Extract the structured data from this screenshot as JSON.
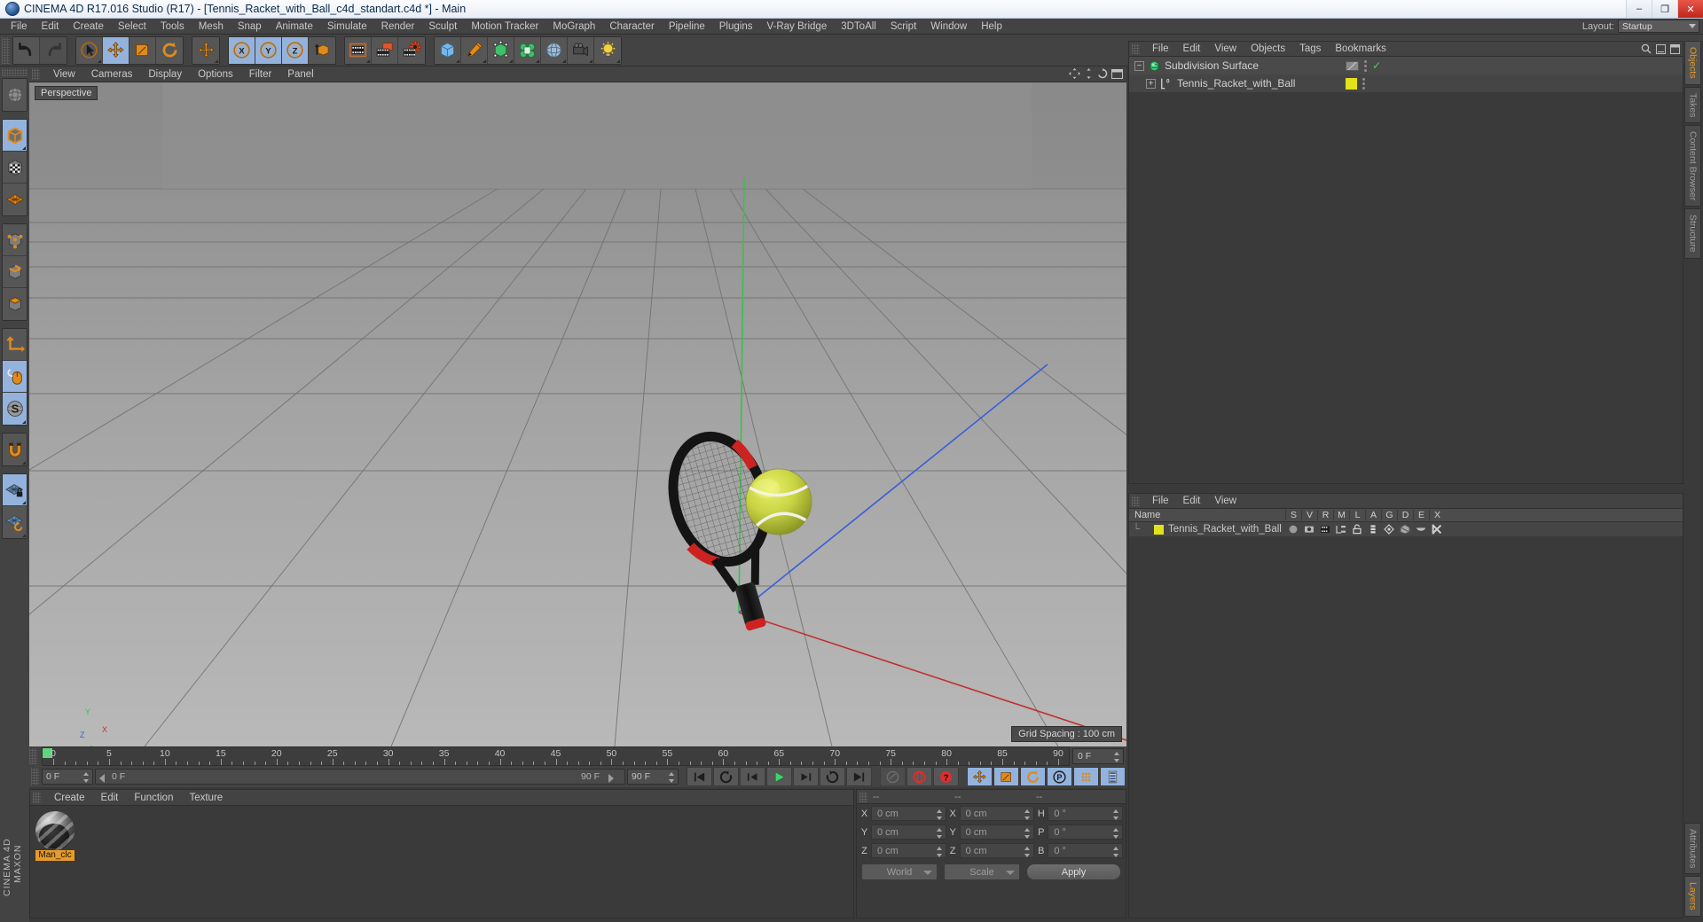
{
  "window": {
    "title": "CINEMA 4D R17.016 Studio (R17) - [Tennis_Racket_with_Ball_c4d_standart.c4d *] - Main",
    "minimize": "–",
    "maximize": "❐",
    "close": "✕"
  },
  "menubar": {
    "items": [
      "File",
      "Edit",
      "Create",
      "Select",
      "Tools",
      "Mesh",
      "Snap",
      "Animate",
      "Simulate",
      "Render",
      "Sculpt",
      "Motion Tracker",
      "MoGraph",
      "Character",
      "Pipeline",
      "Plugins",
      "V-Ray Bridge",
      "3DToAll",
      "Script",
      "Window",
      "Help"
    ],
    "layout_label": "Layout:",
    "layout_value": "Startup"
  },
  "toolbar": {
    "groups": [
      {
        "name": "undo-redo",
        "buttons": [
          {
            "name": "undo-button",
            "icon": "undo-icon",
            "active": false,
            "dim": false,
            "corner": false
          },
          {
            "name": "redo-button",
            "icon": "redo-icon",
            "active": false,
            "dim": true,
            "corner": false
          }
        ]
      },
      {
        "name": "transform-tools",
        "buttons": [
          {
            "name": "live-selection-tool",
            "icon": "cursor-circle-icon",
            "active": false,
            "dim": false,
            "corner": true
          },
          {
            "name": "move-tool",
            "icon": "move-arrows-icon",
            "active": true,
            "dim": false,
            "corner": false
          },
          {
            "name": "scale-tool",
            "icon": "scale-box-icon",
            "active": false,
            "dim": false,
            "corner": false
          },
          {
            "name": "rotate-tool",
            "icon": "rotate-icon",
            "active": false,
            "dim": false,
            "corner": false
          }
        ]
      },
      {
        "name": "axis-tools",
        "buttons": [
          {
            "name": "world-axis-toggle",
            "icon": "move-arrows-icon",
            "active": false,
            "dim": false,
            "corner": true
          }
        ]
      },
      {
        "name": "axis-locks",
        "buttons": [
          {
            "name": "lock-x-axis",
            "icon": "axis-x-icon",
            "active": true,
            "dim": false,
            "corner": false
          },
          {
            "name": "lock-y-axis",
            "icon": "axis-y-icon",
            "active": true,
            "dim": false,
            "corner": false
          },
          {
            "name": "lock-z-axis",
            "icon": "axis-z-icon",
            "active": true,
            "dim": false,
            "corner": false
          },
          {
            "name": "object-world-coordinate-toggle",
            "icon": "world-object-cube-icon",
            "active": false,
            "dim": false,
            "corner": false
          }
        ]
      },
      {
        "name": "render-tools",
        "buttons": [
          {
            "name": "render-view-button",
            "icon": "render-view-icon",
            "active": false,
            "dim": false,
            "corner": true
          },
          {
            "name": "render-to-picture-viewer-button",
            "icon": "render-picture-icon",
            "active": false,
            "dim": false,
            "corner": false
          },
          {
            "name": "edit-render-settings-button",
            "icon": "render-settings-icon",
            "active": false,
            "dim": false,
            "corner": false
          }
        ]
      },
      {
        "name": "object-creation",
        "buttons": [
          {
            "name": "add-primitive-cube-button",
            "icon": "cube-blue-icon",
            "active": false,
            "dim": false,
            "corner": true
          },
          {
            "name": "add-spline-pen-button",
            "icon": "pen-icon",
            "active": false,
            "dim": false,
            "corner": true
          },
          {
            "name": "add-generator-button",
            "icon": "generator-green-icon",
            "active": false,
            "dim": false,
            "corner": true
          },
          {
            "name": "add-deformer-button",
            "icon": "deformer-green-icon",
            "active": false,
            "dim": false,
            "corner": true
          },
          {
            "name": "add-environment-button",
            "icon": "sky-environment-icon",
            "active": false,
            "dim": false,
            "corner": true
          },
          {
            "name": "add-camera-button",
            "icon": "camera-icon",
            "active": false,
            "dim": false,
            "corner": true
          },
          {
            "name": "add-light-button",
            "icon": "light-bulb-icon",
            "active": false,
            "dim": false,
            "corner": true
          }
        ]
      }
    ]
  },
  "left_toolbar": {
    "groups": [
      {
        "name": "g-select",
        "buttons": [
          {
            "name": "texture-axis-tool",
            "icon": "globe-axis-icon",
            "active": false,
            "corner": false
          }
        ]
      },
      {
        "name": "g-modes",
        "buttons": [
          {
            "name": "make-editable-button",
            "icon": "editable-cube-icon",
            "active": true,
            "corner": true
          },
          {
            "name": "texture-mode-button",
            "icon": "checker-cube-icon",
            "active": false,
            "corner": false
          },
          {
            "name": "workplane-mode-button",
            "icon": "grid-plane-icon",
            "active": false,
            "corner": false
          }
        ]
      },
      {
        "name": "g-components",
        "buttons": [
          {
            "name": "points-mode-button",
            "icon": "points-cube-icon",
            "active": false,
            "corner": false
          },
          {
            "name": "edges-mode-button",
            "icon": "edges-cube-icon",
            "active": false,
            "corner": false
          },
          {
            "name": "polygons-mode-button",
            "icon": "polygons-cube-icon",
            "active": false,
            "corner": false
          }
        ]
      },
      {
        "name": "g-axis",
        "buttons": [
          {
            "name": "enable-axis-button",
            "icon": "axis-L-icon",
            "active": false,
            "corner": false
          },
          {
            "name": "viewport-solo-button",
            "icon": "mouse-icon",
            "active": true,
            "corner": false
          },
          {
            "name": "soft-selection-button",
            "icon": "S-sphere-icon",
            "active": true,
            "corner": true
          }
        ]
      },
      {
        "name": "g-snap",
        "buttons": [
          {
            "name": "enable-snap-button",
            "icon": "magnet-icon",
            "active": false,
            "corner": true
          }
        ]
      },
      {
        "name": "g-workplane",
        "buttons": [
          {
            "name": "lock-workplane-button",
            "icon": "workplane-lock-icon",
            "active": true,
            "corner": true
          },
          {
            "name": "planar-workplane-button",
            "icon": "workplane-rotate-icon",
            "active": false,
            "corner": true
          }
        ]
      }
    ],
    "brand_line1": "MAXON",
    "brand_line2": "CINEMA 4D"
  },
  "viewport": {
    "menu": [
      "View",
      "Cameras",
      "Display",
      "Options",
      "Filter",
      "Panel"
    ],
    "label": "Perspective",
    "grid_spacing": "Grid Spacing : 100 cm",
    "axis_gizmo": {
      "x": "X",
      "y": "Y",
      "z": "Z"
    },
    "scene_objects": [
      "tennis racket",
      "tennis ball"
    ],
    "axis_colors": {
      "x": "#d02b2b",
      "y": "#2bbf3a",
      "z": "#2b4fd0"
    }
  },
  "timeline": {
    "start": 0,
    "end": 90,
    "current_frame": 0,
    "tick_labels": [
      0,
      5,
      10,
      15,
      20,
      25,
      30,
      35,
      40,
      45,
      50,
      55,
      60,
      65,
      70,
      75,
      80,
      85,
      90
    ],
    "frame_field": "0 F"
  },
  "playback": {
    "current_field": "0 F",
    "trackbar_left": "0 F",
    "trackbar_right": "90 F",
    "end_field": "90 F",
    "buttons": [
      {
        "name": "go-to-start-button",
        "icon": "skip-start-icon",
        "active": false,
        "dim": false
      },
      {
        "name": "play-backwards-button",
        "icon": "rewind-loop-icon",
        "active": false,
        "dim": false
      },
      {
        "name": "previous-frame-button",
        "icon": "prev-frame-icon",
        "active": false,
        "dim": false
      },
      {
        "name": "play-forwards-button",
        "icon": "play-icon",
        "active": false,
        "dim": false
      },
      {
        "name": "next-frame-button",
        "icon": "next-frame-icon",
        "active": false,
        "dim": false
      },
      {
        "name": "play-forward-loop-button",
        "icon": "forward-loop-icon",
        "active": false,
        "dim": false
      },
      {
        "name": "go-to-end-button",
        "icon": "skip-end-icon",
        "active": false,
        "dim": false
      },
      {
        "name": "record-active-objects-button",
        "icon": "key-gray-icon",
        "active": false,
        "dim": true
      },
      {
        "name": "autokeying-button",
        "icon": "record-red-icon",
        "active": false,
        "dim": false
      },
      {
        "name": "keyframe-selection-button",
        "icon": "question-red-icon",
        "active": false,
        "dim": false
      },
      {
        "name": "record-position-button",
        "icon": "move-arrows-icon",
        "active": true,
        "dim": false
      },
      {
        "name": "record-scale-button",
        "icon": "scale-box-icon",
        "active": true,
        "dim": false
      },
      {
        "name": "record-rotation-button",
        "icon": "rotate-icon",
        "active": true,
        "dim": false
      },
      {
        "name": "record-pla-button",
        "icon": "P-circle-icon",
        "active": true,
        "dim": false
      },
      {
        "name": "record-parameter-button",
        "icon": "dots-grid-icon",
        "active": true,
        "dim": false
      },
      {
        "name": "animation-layers-button",
        "icon": "layers-bars-icon",
        "active": true,
        "dim": false
      }
    ]
  },
  "materials": {
    "menu": [
      "Create",
      "Edit",
      "Function",
      "Texture"
    ],
    "items": [
      {
        "name": "Man_clc"
      }
    ]
  },
  "coordinates": {
    "headers": [
      "--",
      "--",
      "--"
    ],
    "rows": [
      {
        "l1": "X",
        "v1": "0 cm",
        "l2": "X",
        "v2": "0 cm",
        "l3": "H",
        "v3": "0 °"
      },
      {
        "l1": "Y",
        "v1": "0 cm",
        "l2": "Y",
        "v2": "0 cm",
        "l3": "P",
        "v3": "0 °"
      },
      {
        "l1": "Z",
        "v1": "0 cm",
        "l2": "Z",
        "v2": "0 cm",
        "l3": "B",
        "v3": "0 °"
      }
    ],
    "system": "World",
    "mode": "Scale",
    "apply": "Apply"
  },
  "objects_panel": {
    "menu": [
      "File",
      "Edit",
      "View",
      "Objects",
      "Tags",
      "Bookmarks"
    ],
    "rows": [
      {
        "name": "Subdivision Surface",
        "indent": 0,
        "icon": "subdivision-surface-icon",
        "swatch": null,
        "check": true,
        "expander": "−"
      },
      {
        "name": "Tennis_Racket_with_Ball",
        "indent": 1,
        "icon": "null-object-icon",
        "swatch": "#e2e21a",
        "check": false,
        "expander": "+"
      }
    ]
  },
  "layers_panel": {
    "menu": [
      "File",
      "Edit",
      "View"
    ],
    "name_header": "Name",
    "columns": [
      "S",
      "V",
      "R",
      "M",
      "L",
      "A",
      "G",
      "D",
      "E",
      "X"
    ],
    "rows": [
      {
        "name": "Tennis_Racket_with_Ball",
        "color": "#e2e21a"
      }
    ]
  },
  "right_tabs": {
    "top": [
      {
        "label": "Objects",
        "active": true
      },
      {
        "label": "Takes",
        "active": false
      },
      {
        "label": "Content Browser",
        "active": false
      },
      {
        "label": "Structure",
        "active": false
      }
    ],
    "bottom": [
      {
        "label": "Attributes",
        "active": false
      },
      {
        "label": "Layers",
        "active": true
      }
    ]
  }
}
